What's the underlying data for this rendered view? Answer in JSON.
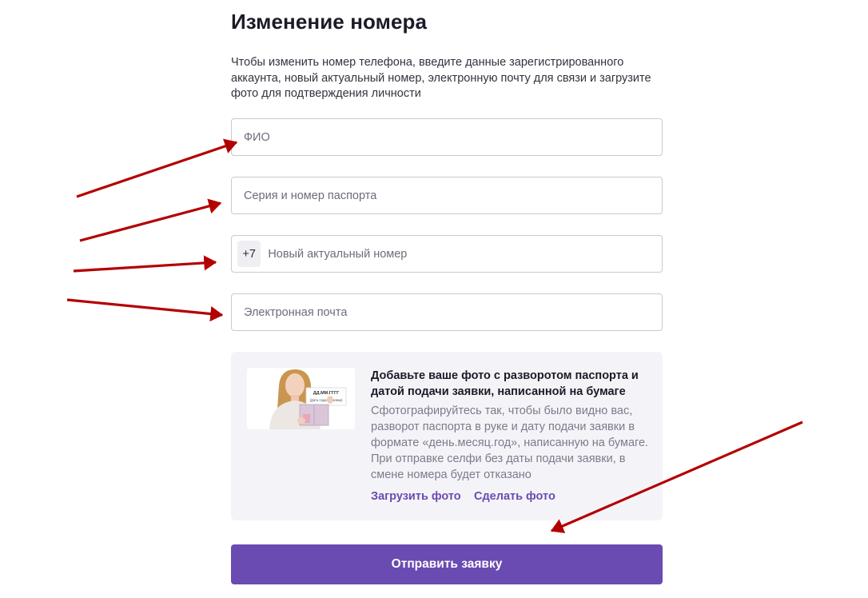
{
  "page": {
    "title": "Изменение номера",
    "description": "Чтобы изменить номер телефона, введите данные зарегистрированного аккаунта, новый актуальный номер, электронную почту для связи и загрузите фото для подтверждения личности"
  },
  "fields": {
    "fio": {
      "placeholder": "ФИО",
      "value": ""
    },
    "passport": {
      "placeholder": "Серия и номер паспорта",
      "value": ""
    },
    "phone": {
      "prefix": "+7",
      "placeholder": "Новый актуальный номер",
      "value": ""
    },
    "email": {
      "placeholder": "Электронная почта",
      "value": ""
    }
  },
  "photo_card": {
    "title": "Добавьте ваше фото с разворотом паспорта и датой подачи заявки, написанной на бумаге",
    "text": "Сфотографируйтесь так, чтобы было видно вас, разворот паспорта в руке и дату подачи заявки в формате «день.месяц.год», написанную на бумаге. При отправке селфи без даты подачи заявки, в смене номера будет отказано",
    "upload_label": "Загрузить фото",
    "take_label": "Сделать фото",
    "sample_sign_line1": "ДД.ММ.ГГГГ",
    "sample_sign_line2": "(Дата подачи заявки)"
  },
  "submit_label": "Отправить заявку",
  "colors": {
    "accent": "#6a4bb1",
    "annotation_arrow": "#b30000",
    "card_background": "#f4f4f8"
  }
}
